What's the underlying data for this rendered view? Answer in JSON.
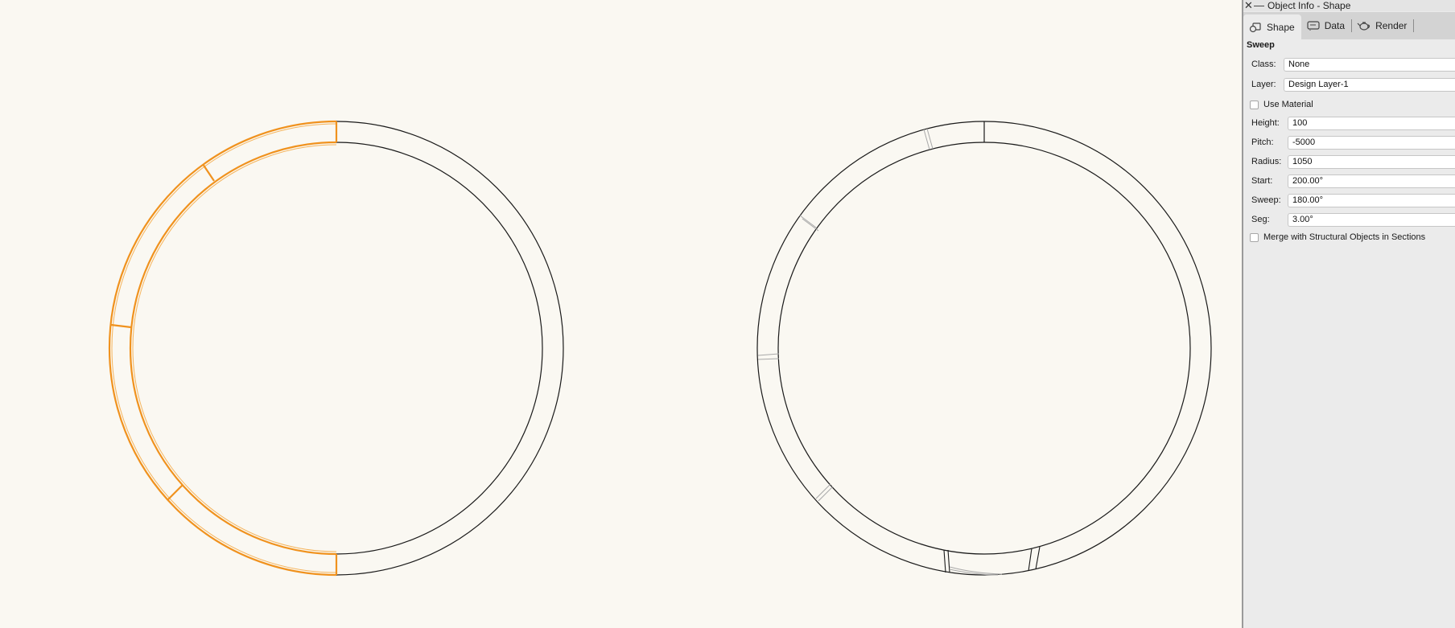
{
  "window": {
    "title": "Object Info - Shape",
    "close_glyph": "✕",
    "minimize_glyph": "—"
  },
  "tabs": [
    {
      "label": "Shape",
      "icon": "shape-icon",
      "active": true
    },
    {
      "label": "Data",
      "icon": "data-icon",
      "active": false
    },
    {
      "label": "Render",
      "icon": "teapot-icon",
      "active": false
    }
  ],
  "section": {
    "title": "Sweep"
  },
  "fields": {
    "class": {
      "label": "Class:",
      "value": "None"
    },
    "layer": {
      "label": "Layer:",
      "value": "Design Layer-1"
    },
    "use_material": {
      "label": "Use Material",
      "checked": false
    },
    "height": {
      "label": "Height:",
      "value": "100"
    },
    "pitch": {
      "label": "Pitch:",
      "value": "-5000"
    },
    "radius": {
      "label": "Radius:",
      "value": "1050"
    },
    "start": {
      "label": "Start:",
      "value": "200.00°"
    },
    "sweep": {
      "label": "Sweep:",
      "value": "180.00°"
    },
    "seg": {
      "label": "Seg:",
      "value": "3.00°"
    },
    "merge": {
      "label": "Merge with Structural Objects in Sections",
      "checked": false
    }
  },
  "colors": {
    "canvas_bg": "#faf8f2",
    "selection": "#f0921e",
    "outline": "#1a1a1a",
    "faint": "#a8a8a8",
    "panel_bg": "#ebebeb"
  }
}
